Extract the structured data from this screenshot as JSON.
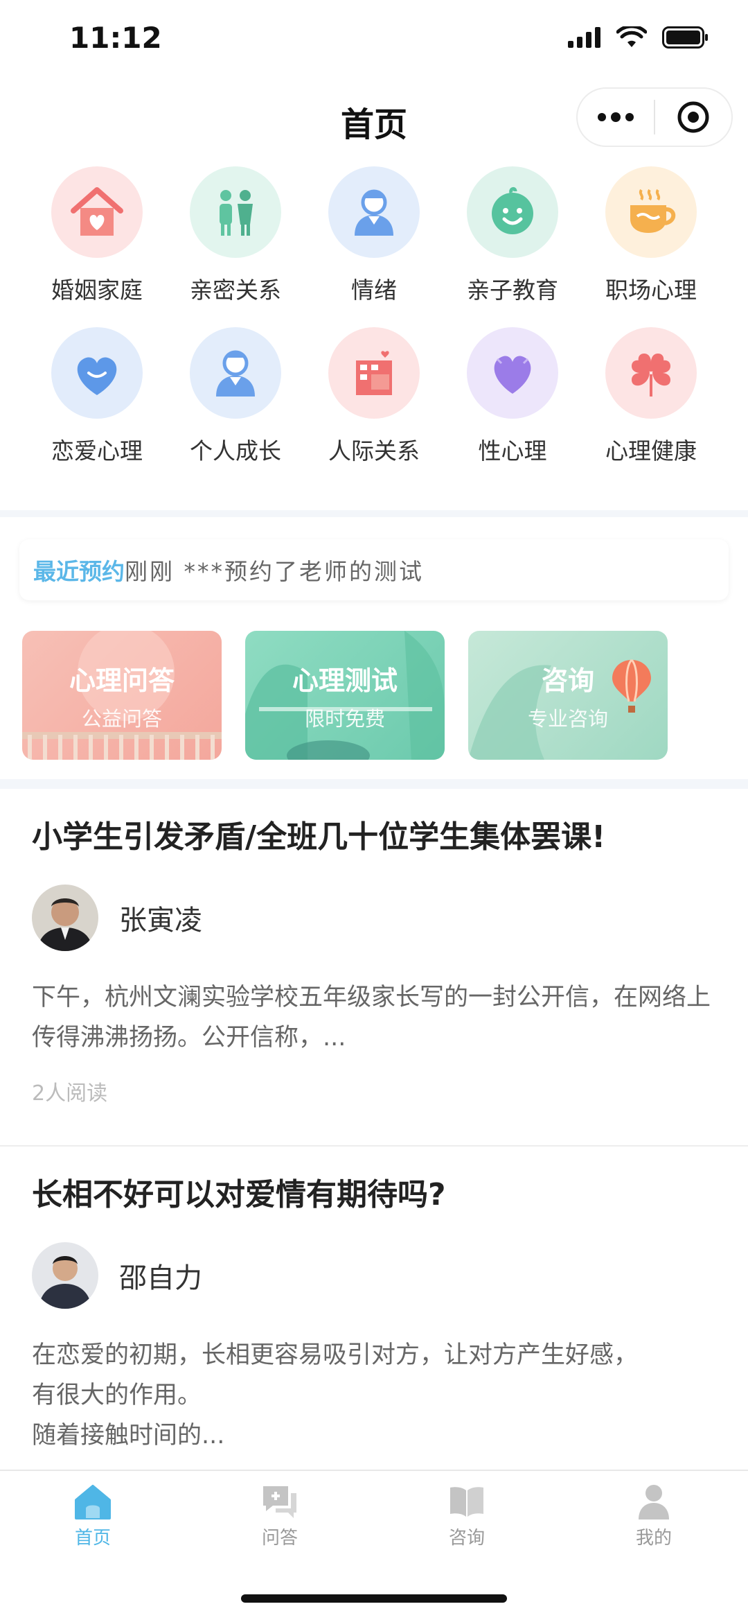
{
  "status": {
    "time": "11:12"
  },
  "nav": {
    "title": "首页"
  },
  "categories": [
    {
      "label": "婚姻家庭",
      "icon": "house-heart-icon",
      "bg": "#fde4e4",
      "color": "#f07070"
    },
    {
      "label": "亲密关系",
      "icon": "couple-icon",
      "bg": "#e2f5ee",
      "color": "#5fc4a0"
    },
    {
      "label": "情绪",
      "icon": "person-icon",
      "bg": "#e3edfb",
      "color": "#6aa0ea"
    },
    {
      "label": "亲子教育",
      "icon": "baby-face-icon",
      "bg": "#dff3ec",
      "color": "#56c39e"
    },
    {
      "label": "职场心理",
      "icon": "coffee-cup-icon",
      "bg": "#fef0dc",
      "color": "#f5b04e"
    },
    {
      "label": "恋爱心理",
      "icon": "heart-bubble-icon",
      "bg": "#e2ecfb",
      "color": "#5d98e8"
    },
    {
      "label": "个人成长",
      "icon": "person-icon",
      "bg": "#e3edfb",
      "color": "#6aa0ea"
    },
    {
      "label": "人际关系",
      "icon": "building-icon",
      "bg": "#fde4e4",
      "color": "#f07070"
    },
    {
      "label": "性心理",
      "icon": "heart-icon",
      "bg": "#ede6fb",
      "color": "#9b7ce8"
    },
    {
      "label": "心理健康",
      "icon": "clover-icon",
      "bg": "#fde4e4",
      "color": "#f07070"
    }
  ],
  "notice": {
    "highlight": "最近预约",
    "text": "刚刚 ***预约了老师的测试"
  },
  "cards": [
    {
      "title": "心理问答",
      "subtitle": "公益问答"
    },
    {
      "title": "心理测试",
      "subtitle": "限时免费"
    },
    {
      "title": "咨询",
      "subtitle": "专业咨询"
    }
  ],
  "articles": [
    {
      "title": "小学生引发矛盾/全班几十位学生集体罢课!",
      "author": "张寅凌",
      "excerpt": "下午，杭州文澜实验学校五年级家长写的一封公开信，在网络上传得沸沸扬扬。公开信称，...",
      "reads": "2人阅读"
    },
    {
      "title": "长相不好可以对爱情有期待吗?",
      "author": "邵自力",
      "excerpt_lines": [
        "在恋爱的初期，长相更容易吸引对方，让对方产生好感，",
        "有很大的作用。",
        "随着接触时间的..."
      ]
    }
  ],
  "tabs": [
    {
      "label": "首页",
      "icon": "home-icon",
      "active": true
    },
    {
      "label": "问答",
      "icon": "chat-plus-icon",
      "active": false
    },
    {
      "label": "咨询",
      "icon": "book-icon",
      "active": false
    },
    {
      "label": "我的",
      "icon": "user-icon",
      "active": false
    }
  ],
  "colors": {
    "accent": "#4fb6e6",
    "card1": "#f7b0a8",
    "card2": "#7fd3b8",
    "card3": "#a9dccb"
  }
}
